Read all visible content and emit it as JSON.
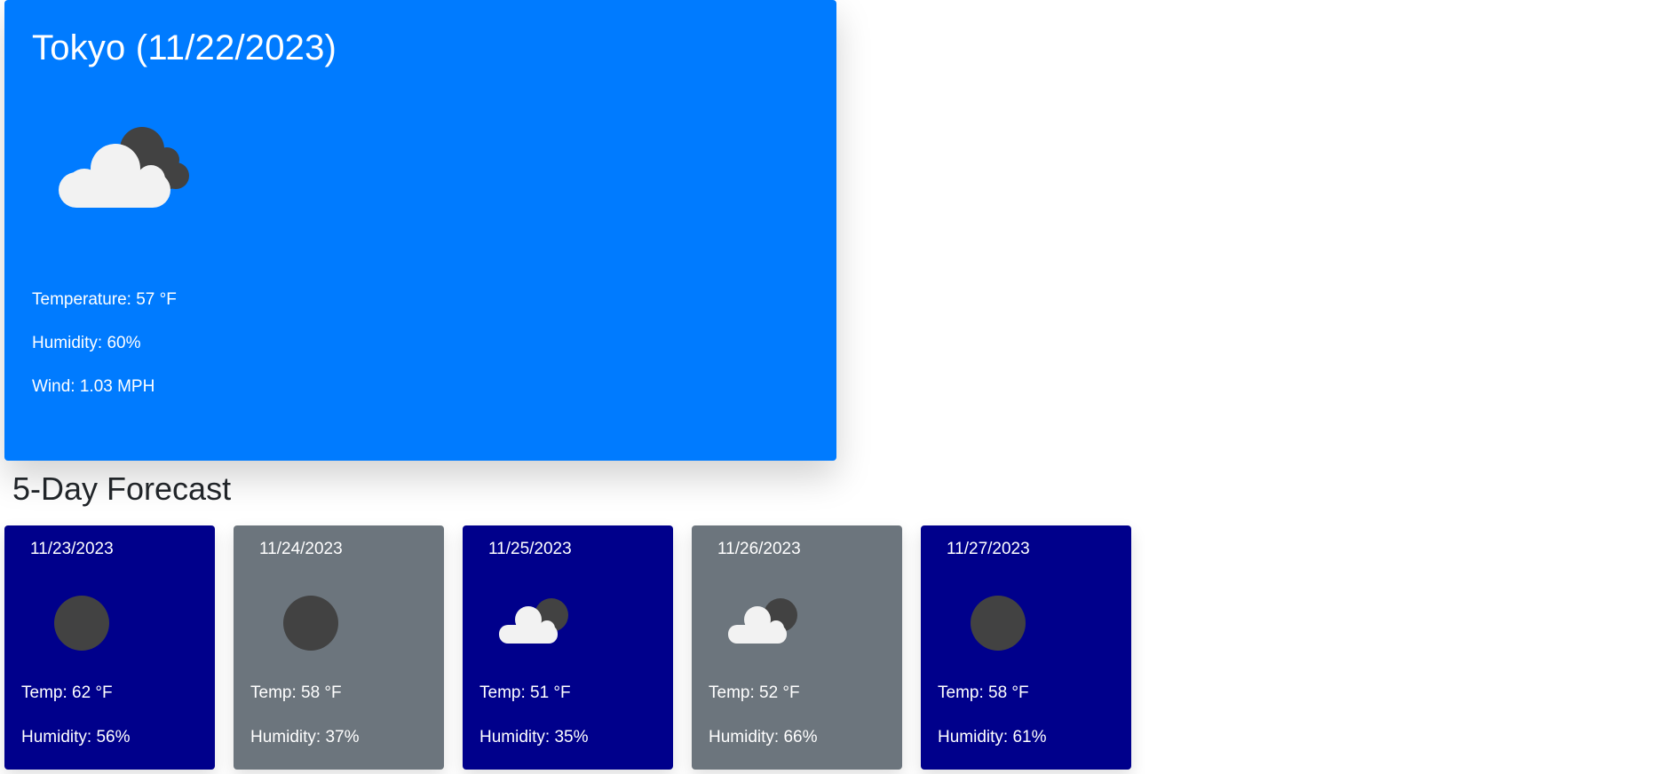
{
  "current": {
    "title": "Tokyo (11/22/2023)",
    "icon": "broken-clouds-icon",
    "temperature": "Temperature: 57 °F",
    "humidity": "Humidity: 60%",
    "wind": "Wind: 1.03 MPH",
    "color": "#007bff"
  },
  "forecast": {
    "heading": "5-Day Forecast",
    "days": [
      {
        "date": "11/23/2023",
        "icon": "moon-icon",
        "temp": "Temp: 62 °F",
        "humidity": "Humidity: 56%",
        "color": "#00008b"
      },
      {
        "date": "11/24/2023",
        "icon": "moon-icon",
        "temp": "Temp: 58 °F",
        "humidity": "Humidity: 37%",
        "color": "#6c757d"
      },
      {
        "date": "11/25/2023",
        "icon": "broken-clouds-icon",
        "temp": "Temp: 51 °F",
        "humidity": "Humidity: 35%",
        "color": "#00008b"
      },
      {
        "date": "11/26/2023",
        "icon": "broken-clouds-icon",
        "temp": "Temp: 52 °F",
        "humidity": "Humidity: 66%",
        "color": "#6c757d"
      },
      {
        "date": "11/27/2023",
        "icon": "moon-icon",
        "temp": "Temp: 58 °F",
        "humidity": "Humidity: 61%",
        "color": "#00008b"
      }
    ]
  }
}
